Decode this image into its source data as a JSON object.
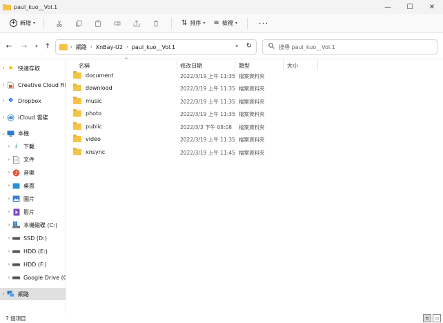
{
  "window": {
    "title": "paul_kuo__Vol.1",
    "minimize_glyph": "—",
    "maximize_glyph": "☐",
    "close_glyph": "✕"
  },
  "commandbar": {
    "new_label": "新增",
    "sort_label": "排序",
    "view_label": "檢視",
    "more_label": "···",
    "tool_icons": [
      "cut-icon",
      "copy-icon",
      "paste-icon",
      "rename-icon",
      "share-icon",
      "delete-icon"
    ]
  },
  "address": {
    "crumbs": [
      "網路",
      "XnBay-U2",
      "paul_kuo__Vol.1"
    ]
  },
  "search": {
    "placeholder": "搜尋 paul_kuo__Vol.1"
  },
  "sidebar": {
    "items": [
      {
        "label": "快速存取",
        "icon": "star-icon",
        "color": "#f2b705"
      },
      {
        "label": "Creative Cloud File",
        "icon": "creative-cloud-icon",
        "color": "#e8572a"
      },
      {
        "label": "Dropbox",
        "icon": "dropbox-icon",
        "color": "#0061fe"
      },
      {
        "label": "iCloud 雲碟",
        "icon": "icloud-icon",
        "color": "#3b8fe0"
      },
      {
        "label": "本機",
        "icon": "this-pc-icon",
        "color": "#2a7ad0"
      },
      {
        "label": "下載",
        "icon": "download-icon",
        "color": "#1c9a5b"
      },
      {
        "label": "文件",
        "icon": "documents-icon",
        "color": "#6b7b8c"
      },
      {
        "label": "音樂",
        "icon": "music-icon",
        "color": "#e25a3d"
      },
      {
        "label": "桌面",
        "icon": "desktop-icon",
        "color": "#2a8fd8"
      },
      {
        "label": "圖片",
        "icon": "pictures-icon",
        "color": "#3a7fd0"
      },
      {
        "label": "影片",
        "icon": "videos-icon",
        "color": "#7a4cc4"
      },
      {
        "label": "本機磁碟 (C:)",
        "icon": "windows-drive-icon",
        "color": "#2a7ad0"
      },
      {
        "label": "SSD (D:)",
        "icon": "drive-icon",
        "color": "#555555"
      },
      {
        "label": "HDD (E:)",
        "icon": "drive-icon",
        "color": "#555555"
      },
      {
        "label": "HDD (F:)",
        "icon": "drive-icon",
        "color": "#555555"
      },
      {
        "label": "Google Drive (G:)",
        "icon": "drive-icon",
        "color": "#555555"
      },
      {
        "label": "網路",
        "icon": "network-icon",
        "color": "#2a7ad0"
      }
    ]
  },
  "columns": {
    "name": "名稱",
    "date": "修改日期",
    "type": "類型",
    "size": "大小"
  },
  "files": [
    {
      "name": "document",
      "date": "2022/3/19 上午 11:35",
      "type": "檔案資料夾"
    },
    {
      "name": "download",
      "date": "2022/3/19 上午 11:35",
      "type": "檔案資料夾"
    },
    {
      "name": "music",
      "date": "2022/3/19 上午 11:35",
      "type": "檔案資料夾"
    },
    {
      "name": "photo",
      "date": "2022/3/19 上午 11:35",
      "type": "檔案資料夾"
    },
    {
      "name": "public",
      "date": "2022/3/3 下午 08:08",
      "type": "檔案資料夾"
    },
    {
      "name": "video",
      "date": "2022/3/19 上午 11:35",
      "type": "檔案資料夾"
    },
    {
      "name": "xnsync",
      "date": "2022/3/19 上午 11:45",
      "type": "檔案資料夾"
    }
  ],
  "status": {
    "item_count": "7 個項目"
  },
  "colors": {
    "folder": "#f6c445",
    "selection": "#e0e0e0"
  }
}
